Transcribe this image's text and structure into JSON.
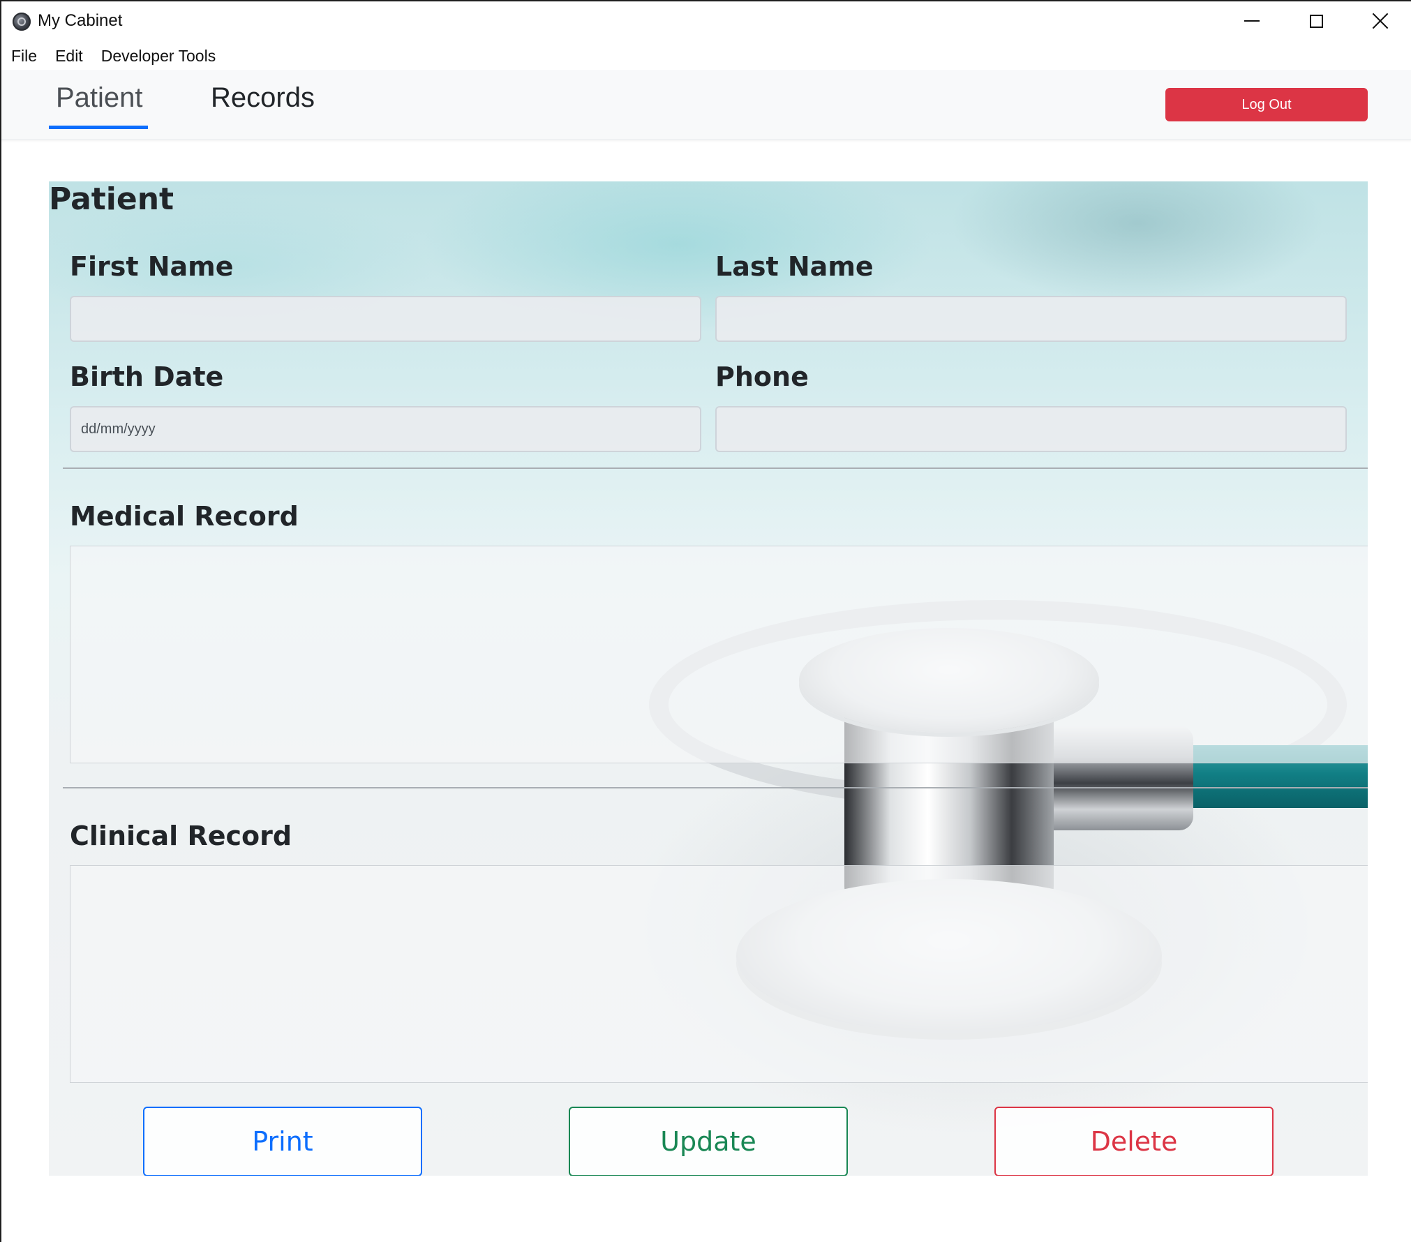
{
  "window": {
    "title": "My Cabinet"
  },
  "menu": {
    "items": [
      "File",
      "Edit",
      "Developer Tools"
    ]
  },
  "nav": {
    "tabs": [
      {
        "label": "Patient",
        "active": true
      },
      {
        "label": "Records",
        "active": false
      }
    ],
    "logout_label": "Log Out"
  },
  "patient_form": {
    "title": "Patient",
    "first_name_label": "First Name",
    "first_name_value": "",
    "last_name_label": "Last Name",
    "last_name_value": "",
    "birth_date_label": "Birth Date",
    "birth_date_placeholder": "dd/mm/yyyy",
    "phone_label": "Phone",
    "phone_value": "",
    "medical_record_label": "Medical Record",
    "medical_record_value": "",
    "clinical_record_label": "Clinical Record",
    "clinical_record_value": ""
  },
  "actions": {
    "print_label": "Print",
    "update_label": "Update",
    "delete_label": "Delete"
  },
  "colors": {
    "primary": "#0d6efd",
    "success": "#198754",
    "danger": "#dc3545"
  },
  "icons": {
    "app": "app-logo-icon",
    "minimize": "minimize-icon",
    "maximize": "maximize-icon",
    "close": "close-icon"
  }
}
